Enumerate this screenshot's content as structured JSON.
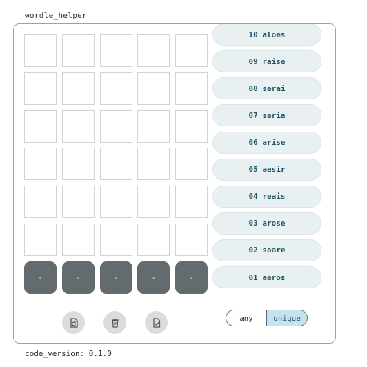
{
  "app": {
    "title": "wordle_helper",
    "version": "code_version: 0.1.0"
  },
  "grid": {
    "rows": 6,
    "cols": 5,
    "entry_row": [
      "-",
      "-",
      "-",
      "-",
      "-"
    ]
  },
  "words": [
    "10 aloes",
    "09 raise",
    "08 serai",
    "07 seria",
    "06 arise",
    "05 aesir",
    "04 reais",
    "03 arose",
    "02 soare",
    "01 aeros"
  ],
  "actions": [
    {
      "name": "reset-button",
      "icon": "reset-icon"
    },
    {
      "name": "clear-button",
      "icon": "delete-icon"
    },
    {
      "name": "submit-button",
      "icon": "check-document-icon"
    }
  ],
  "mode": {
    "options": [
      "any",
      "unique"
    ],
    "selected": "unique"
  },
  "colors": {
    "entry_tile": "#636b6f",
    "word_text": "#1f5566",
    "selected_mode": "#c4e3ec"
  }
}
